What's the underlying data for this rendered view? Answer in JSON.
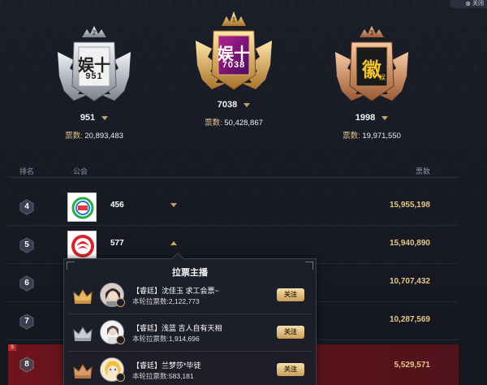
{
  "header": {
    "close_label": "关闭"
  },
  "podium": [
    {
      "rank": "2",
      "name": "951",
      "votes_label": "票数:",
      "votes": "20,893,483",
      "logo_text": "娱十",
      "logo_sub": "951"
    },
    {
      "rank": "1",
      "name": "7038",
      "votes_label": "票数:",
      "votes": "50,428,867",
      "logo_text": "娱十",
      "logo_sub": "7038"
    },
    {
      "rank": "3",
      "name": "1998",
      "votes_label": "票数:",
      "votes": "19,971,550",
      "logo_text": "徽",
      "logo_sub": "娱"
    }
  ],
  "table": {
    "col_rank": "排名",
    "col_guild": "公会",
    "col_votes": "票数"
  },
  "rows": [
    {
      "rank": "4",
      "name": "456",
      "votes": "15,955,198"
    },
    {
      "rank": "5",
      "name": "577",
      "votes": "15,940,890"
    },
    {
      "rank": "6",
      "name": "",
      "votes": "10,707,432"
    },
    {
      "rank": "7",
      "name": "",
      "votes": "10,287,569"
    },
    {
      "rank": "8",
      "name": "",
      "votes": "5,529,571",
      "tag": "S"
    }
  ],
  "popup": {
    "title": "拉票主播",
    "items": [
      {
        "rank": "1",
        "name": "【睿廷】沈佳玉 求工会票~",
        "votes_label": "本轮拉票数:",
        "votes": "2,122,773",
        "button": "关注"
      },
      {
        "rank": "2",
        "name": "【睿廷】浅蓝 吉人自有天相",
        "votes_label": "本轮拉票数:",
        "votes": "1,914,696",
        "button": "关注"
      },
      {
        "rank": "3",
        "name": "【睿廷】兰梦莎*毕徒",
        "votes_label": "本轮拉票数:",
        "votes": "583,181",
        "button": "关注"
      }
    ]
  },
  "colors": {
    "gold": "#e8c688",
    "silver": "#c9ccd3",
    "bronze": "#d49a6a",
    "highlight_row": "#7a1620"
  }
}
